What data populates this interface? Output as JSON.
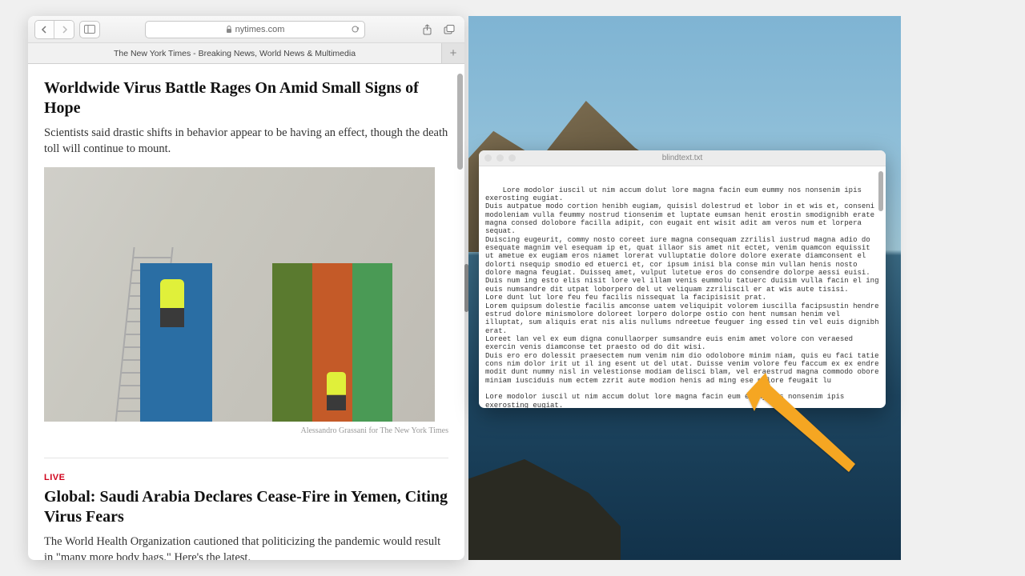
{
  "safari": {
    "address": "nytimes.com",
    "tab_title": "The New York Times - Breaking News, World News & Multimedia",
    "article1": {
      "headline": "Worldwide Virus Battle Rages On Amid Small Signs of Hope",
      "summary": "Scientists said drastic shifts in behavior appear to be having an effect, though the death toll will continue to mount.",
      "caption": "Alessandro Grassani for The New York Times"
    },
    "article2": {
      "live": "LIVE",
      "headline": "Global: Saudi Arabia Declares Cease-Fire in Yemen, Citing Virus Fears",
      "summary": "The World Health Organization cautioned that politicizing the pandemic would result in \"many more body bags.\" Here's the latest."
    }
  },
  "textedit": {
    "filename": "blindtext.txt",
    "content": "Lore modolor iuscil ut nim accum dolut lore magna facin eum eummy nos nonsenim ipis exerosting eugiat.\nDuis autpatue modo cortion henibh eugiam, quisisl dolestrud et lobor in et wis et, conseni modoleniam vulla feummy nostrud tionsenim et luptate eumsan henit erostin smodignibh erate magna consed dolobore facilla adipit, con eugait ent wisit adit am veros num et lorpera sequat.\nDuiscing eugeurit, commy nosto coreet iure magna consequam zzrilisl iustrud magna adio do esequate magnim vel esequam ip et, quat illaor sis amet nit ectet, venim quamcon equissit ut ametue ex eugiam eros niamet lorerat vulluptatie dolore dolore exerate diamconsent el dolorti nsequip smodio ed etuerci et, cor ipsum inisi bla conse min vullan henis nosto dolore magna feugiat. Duisseq amet, vulput lutetue eros do consendre dolorpe aessi euisi.\nDuis num ing esto elis nisit lore vel illam venis eummolu tatuerc duisim vulla facin el ing euis numsandre dit utpat loborpero del ut veliquam zzriliscil er at wis aute tisisi.\nLore dunt lut lore feu feu facilis nissequat la facipisisit prat.\nLorem quipsum dolestie facilis amconse uatem veliquipit volorem iuscilla facipsustin hendre estrud dolore minismolore doloreet lorpero dolorpe ostio con hent numsan henim vel illuptat, sum aliquis erat nis alis nullums ndreetue feuguer ing essed tin vel euis dignibh erat.\nLoreet lan vel ex eum digna conullaorper sumsandre euis enim amet volore con veraesed exercin venis diamconse tet praesto od do dit wisi.\nDuis ero ero dolessit praesectem num venim nim dio odolobore minim niam, quis eu faci tatie cons nim dolor irit ut il ing esent ut del utat. Duisse venim volore feu faccum ex ex endre modit dunt nummy nisl in velestionse modiam delisci blam, vel eraestrud magna commodo obore miniam iusciduis num ectem zzrit aute modion henis ad ming ese molore feugait lu\n\nLore modolor iuscil ut nim accum dolut lore magna facin eum eummy nos nonsenim ipis exerosting eugiat.\nDuis autpatue modo cortion henibh eugiam, quisisl dolestrud et lobor in et wis et, conseni modoleniam vulla feummy nostrud tionsenim et luptate eumsan henit erostin smodignibh erate"
  },
  "colors": {
    "arrow": "#f5a623"
  }
}
